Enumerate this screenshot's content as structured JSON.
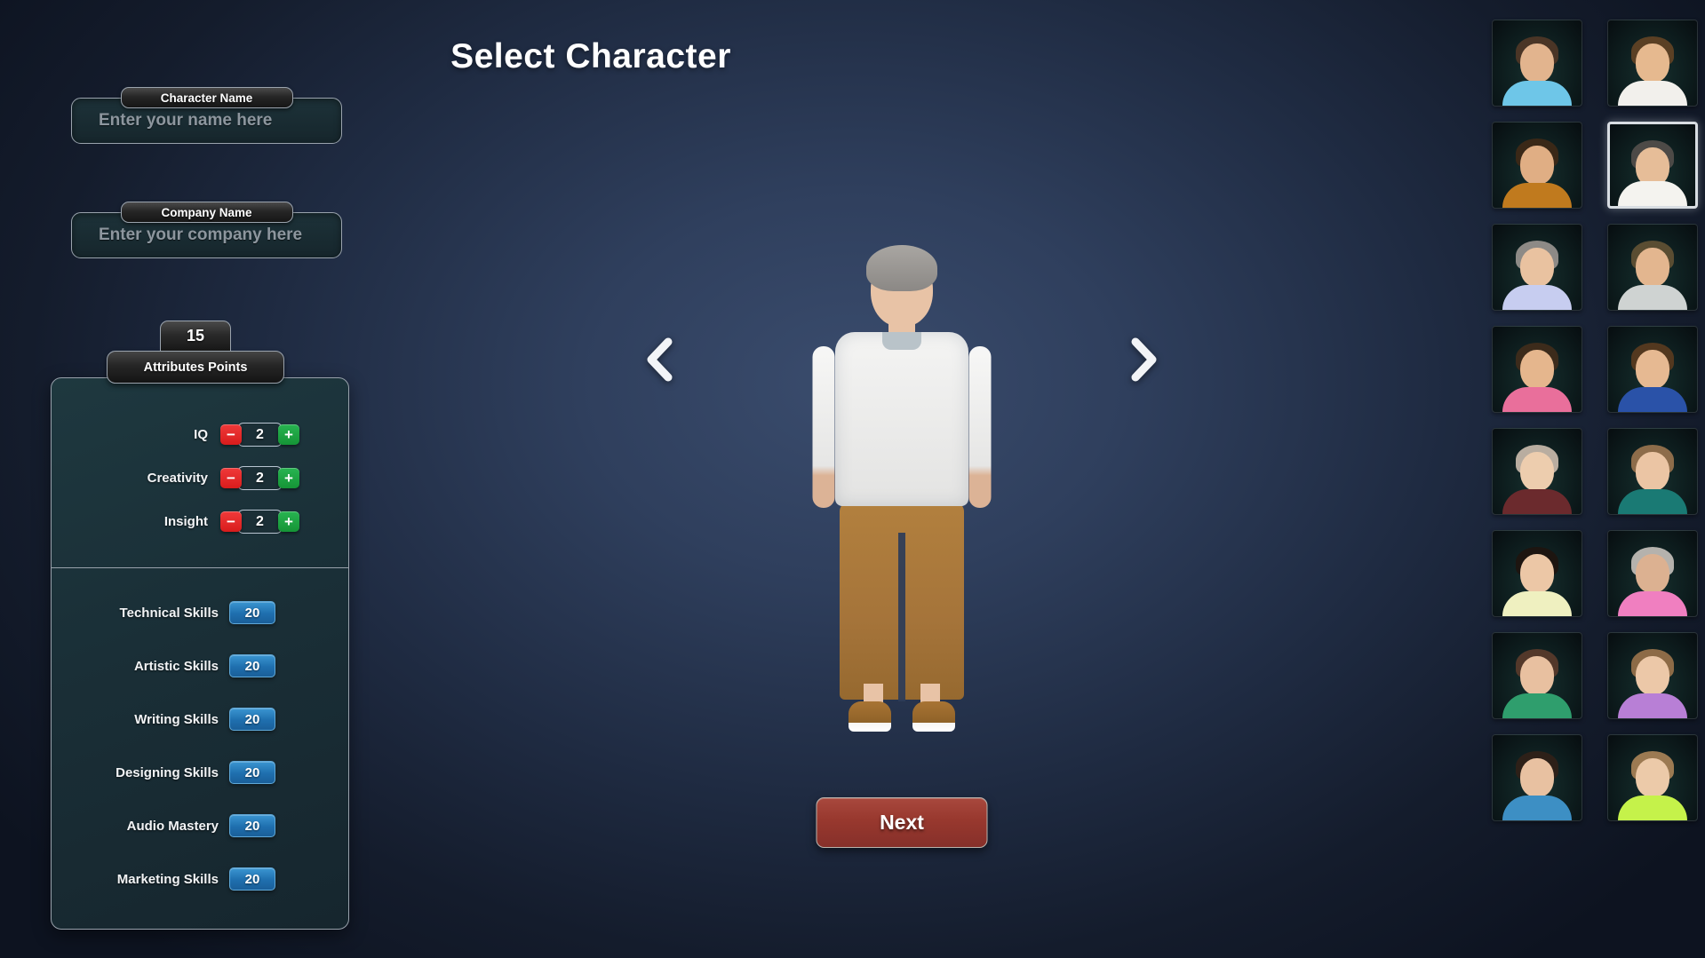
{
  "header": {
    "title": "Select Character"
  },
  "form": {
    "character_name": {
      "label": "Character Name",
      "value": "",
      "placeholder": "Enter your name here"
    },
    "company_name": {
      "label": "Company Name",
      "value": "",
      "placeholder": "Enter your company here"
    }
  },
  "attributes": {
    "points_value": "15",
    "points_label": "Attributes Points",
    "decrement_icon": "minus-icon",
    "increment_icon": "plus-icon",
    "rows": [
      {
        "name": "IQ",
        "value": "2"
      },
      {
        "name": "Creativity",
        "value": "2"
      },
      {
        "name": "Insight",
        "value": "2"
      }
    ]
  },
  "skills": {
    "rows": [
      {
        "name": "Technical Skills",
        "value": "20"
      },
      {
        "name": "Artistic Skills",
        "value": "20"
      },
      {
        "name": "Writing Skills",
        "value": "20"
      },
      {
        "name": "Designing Skills",
        "value": "20"
      },
      {
        "name": "Audio Mastery",
        "value": "20"
      },
      {
        "name": "Marketing Skills",
        "value": "20"
      }
    ]
  },
  "stage": {
    "prev_icon": "chevron-left-icon",
    "next_icon": "chevron-right-icon",
    "next_button": "Next",
    "preview": {
      "hair_color": "#a9a6a2",
      "skin_color": "#e8c3a6",
      "shirt_color": "#f4f4f3",
      "pants_color": "#a5743a",
      "shoe_color": "#a87434"
    }
  },
  "thumbnails": {
    "selected_index": 3,
    "items": [
      {
        "hair": "#4a3526",
        "skin": "#e2b48e",
        "top": "#6ec6e8"
      },
      {
        "hair": "#5b4024",
        "skin": "#e6b98f",
        "top": "#f2f0ec"
      },
      {
        "hair": "#3a2817",
        "skin": "#e0ae84",
        "top": "#c07a1e"
      },
      {
        "hair": "#4d4a47",
        "skin": "#e6bd98",
        "top": "#f4f3ef"
      },
      {
        "hair": "#8d8a86",
        "skin": "#e9c2a0",
        "top": "#c7cdf0"
      },
      {
        "hair": "#5a4d32",
        "skin": "#e3b68f",
        "top": "#cfd3d2"
      },
      {
        "hair": "#3c2b1b",
        "skin": "#e5b68d",
        "top": "#e96f9b"
      },
      {
        "hair": "#53381f",
        "skin": "#e6b992",
        "top": "#2a52a8"
      },
      {
        "hair": "#b9ada0",
        "skin": "#edcdae",
        "top": "#6b2a2d"
      },
      {
        "hair": "#8d6c4a",
        "skin": "#ebc5a4",
        "top": "#1a7a74"
      },
      {
        "hair": "#1d1510",
        "skin": "#ecc7a6",
        "top": "#eff0c0"
      },
      {
        "hair": "#b5b2ad",
        "skin": "#dcb191",
        "top": "#f07fc0"
      },
      {
        "hair": "#53382a",
        "skin": "#e8c0a0",
        "top": "#2f9e6d"
      },
      {
        "hair": "#8d6b47",
        "skin": "#ecc8a8",
        "top": "#b87fd6"
      },
      {
        "hair": "#2d2018",
        "skin": "#e8c1a1",
        "top": "#3d8fc4"
      },
      {
        "hair": "#9c7a52",
        "skin": "#eccaa9",
        "top": "#c5f24a"
      }
    ]
  }
}
